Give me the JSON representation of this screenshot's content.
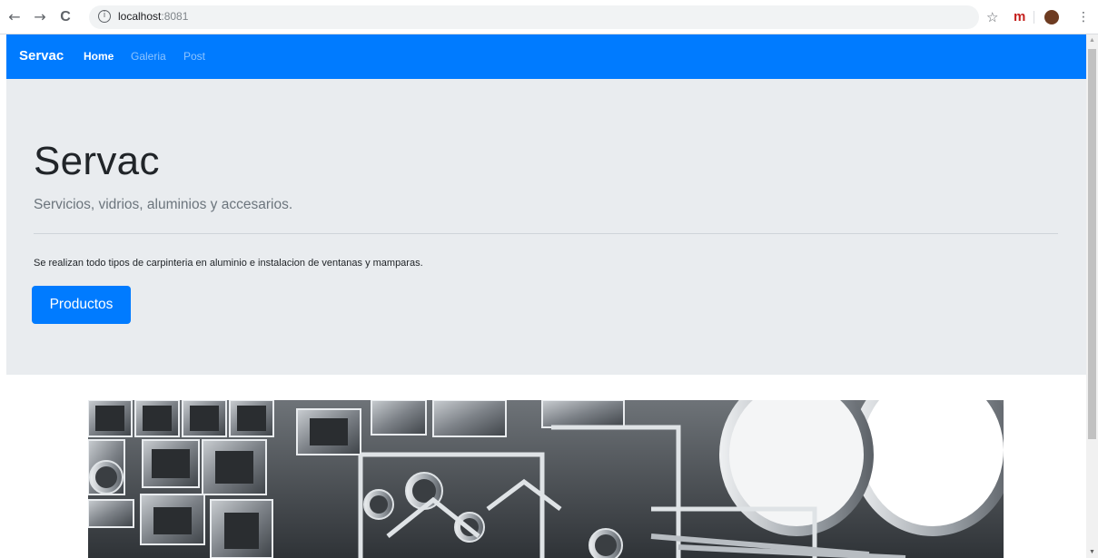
{
  "browser": {
    "back_icon": "←",
    "forward_icon": "→",
    "reload_icon": "C",
    "url_host": "localhost",
    "url_port": ":8081",
    "bookmark_icon": "☆",
    "extension_label": "m",
    "menu_icon": "⋮"
  },
  "navbar": {
    "brand": "Servac",
    "links": [
      "Home",
      "Galeria",
      "Post"
    ],
    "color": "#007bff"
  },
  "jumbotron": {
    "title": "Servac",
    "lead": "Servicios, vidrios, aluminios y accesarios.",
    "text": "Se realizan todo tipos de carpinteria en aluminio e instalacion de ventanas y mamparas.",
    "button_label": "Productos",
    "background": "#e9ecef"
  },
  "hero_image": {
    "icon": "aluminum-profiles-image"
  }
}
